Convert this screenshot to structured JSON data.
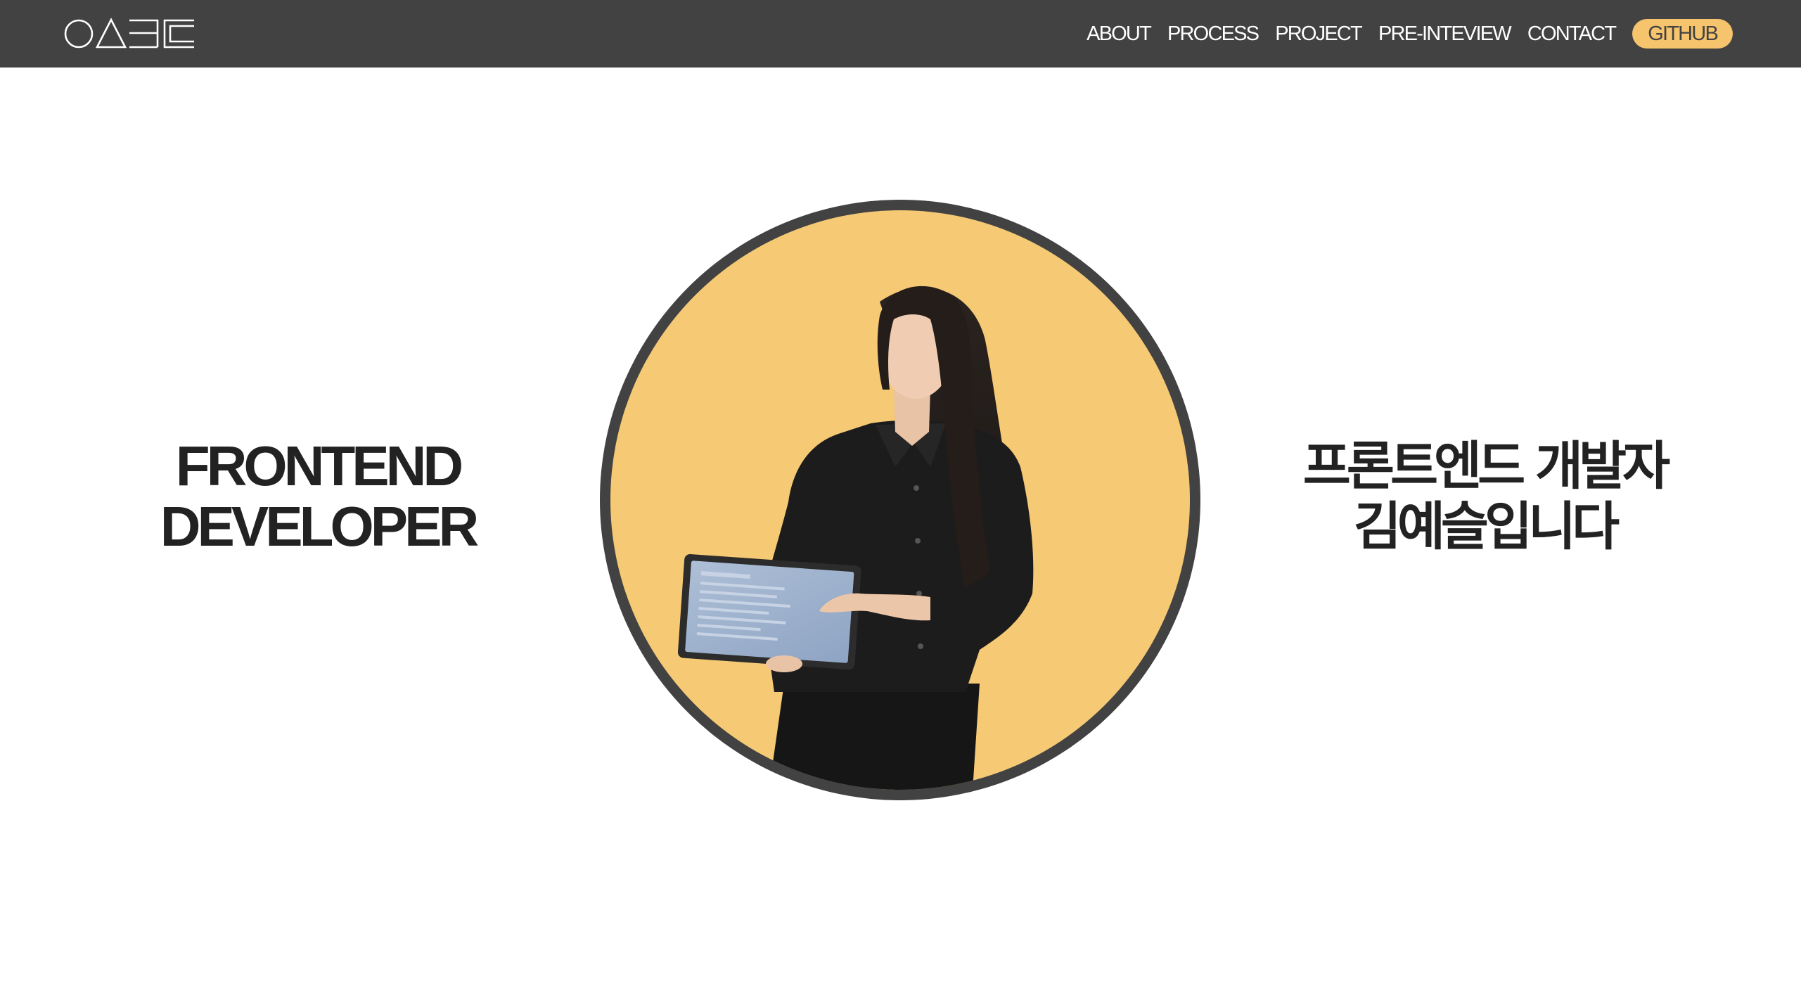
{
  "navbar": {
    "logo_name": "logo-icon",
    "items": [
      {
        "label": "ABOUT"
      },
      {
        "label": "PROCESS"
      },
      {
        "label": "PROJECT"
      },
      {
        "label": "PRE-INTEVIEW"
      },
      {
        "label": "CONTACT"
      }
    ],
    "github_label": "GITHUB"
  },
  "hero": {
    "title_en_line1": "FRONTEND",
    "title_en_line2": "DEVELOPER",
    "title_ko_line1": "프론트엔드 개발자",
    "title_ko_line2": "김예슬입니다",
    "portrait_icon": "developer-portrait"
  },
  "colors": {
    "navbar_bg": "#424242",
    "accent": "#f6c46c",
    "circle_border": "#424242",
    "text_dark": "#222222"
  }
}
